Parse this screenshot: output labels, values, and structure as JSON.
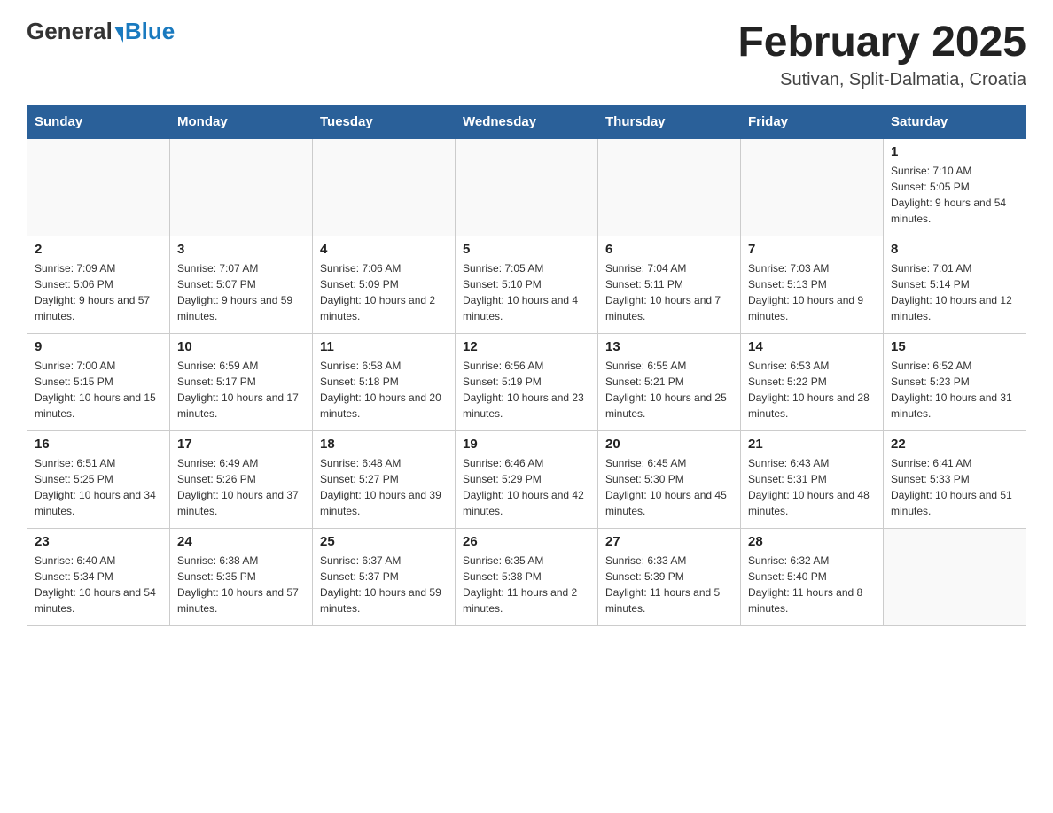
{
  "header": {
    "logo_general": "General",
    "logo_blue": "Blue",
    "title": "February 2025",
    "subtitle": "Sutivan, Split-Dalmatia, Croatia"
  },
  "calendar": {
    "days_of_week": [
      "Sunday",
      "Monday",
      "Tuesday",
      "Wednesday",
      "Thursday",
      "Friday",
      "Saturday"
    ],
    "weeks": [
      {
        "cells": [
          {
            "empty": true
          },
          {
            "empty": true
          },
          {
            "empty": true
          },
          {
            "empty": true
          },
          {
            "empty": true
          },
          {
            "empty": true
          },
          {
            "day": "1",
            "sunrise": "Sunrise: 7:10 AM",
            "sunset": "Sunset: 5:05 PM",
            "daylight": "Daylight: 9 hours and 54 minutes."
          }
        ]
      },
      {
        "cells": [
          {
            "day": "2",
            "sunrise": "Sunrise: 7:09 AM",
            "sunset": "Sunset: 5:06 PM",
            "daylight": "Daylight: 9 hours and 57 minutes."
          },
          {
            "day": "3",
            "sunrise": "Sunrise: 7:07 AM",
            "sunset": "Sunset: 5:07 PM",
            "daylight": "Daylight: 9 hours and 59 minutes."
          },
          {
            "day": "4",
            "sunrise": "Sunrise: 7:06 AM",
            "sunset": "Sunset: 5:09 PM",
            "daylight": "Daylight: 10 hours and 2 minutes."
          },
          {
            "day": "5",
            "sunrise": "Sunrise: 7:05 AM",
            "sunset": "Sunset: 5:10 PM",
            "daylight": "Daylight: 10 hours and 4 minutes."
          },
          {
            "day": "6",
            "sunrise": "Sunrise: 7:04 AM",
            "sunset": "Sunset: 5:11 PM",
            "daylight": "Daylight: 10 hours and 7 minutes."
          },
          {
            "day": "7",
            "sunrise": "Sunrise: 7:03 AM",
            "sunset": "Sunset: 5:13 PM",
            "daylight": "Daylight: 10 hours and 9 minutes."
          },
          {
            "day": "8",
            "sunrise": "Sunrise: 7:01 AM",
            "sunset": "Sunset: 5:14 PM",
            "daylight": "Daylight: 10 hours and 12 minutes."
          }
        ]
      },
      {
        "cells": [
          {
            "day": "9",
            "sunrise": "Sunrise: 7:00 AM",
            "sunset": "Sunset: 5:15 PM",
            "daylight": "Daylight: 10 hours and 15 minutes."
          },
          {
            "day": "10",
            "sunrise": "Sunrise: 6:59 AM",
            "sunset": "Sunset: 5:17 PM",
            "daylight": "Daylight: 10 hours and 17 minutes."
          },
          {
            "day": "11",
            "sunrise": "Sunrise: 6:58 AM",
            "sunset": "Sunset: 5:18 PM",
            "daylight": "Daylight: 10 hours and 20 minutes."
          },
          {
            "day": "12",
            "sunrise": "Sunrise: 6:56 AM",
            "sunset": "Sunset: 5:19 PM",
            "daylight": "Daylight: 10 hours and 23 minutes."
          },
          {
            "day": "13",
            "sunrise": "Sunrise: 6:55 AM",
            "sunset": "Sunset: 5:21 PM",
            "daylight": "Daylight: 10 hours and 25 minutes."
          },
          {
            "day": "14",
            "sunrise": "Sunrise: 6:53 AM",
            "sunset": "Sunset: 5:22 PM",
            "daylight": "Daylight: 10 hours and 28 minutes."
          },
          {
            "day": "15",
            "sunrise": "Sunrise: 6:52 AM",
            "sunset": "Sunset: 5:23 PM",
            "daylight": "Daylight: 10 hours and 31 minutes."
          }
        ]
      },
      {
        "cells": [
          {
            "day": "16",
            "sunrise": "Sunrise: 6:51 AM",
            "sunset": "Sunset: 5:25 PM",
            "daylight": "Daylight: 10 hours and 34 minutes."
          },
          {
            "day": "17",
            "sunrise": "Sunrise: 6:49 AM",
            "sunset": "Sunset: 5:26 PM",
            "daylight": "Daylight: 10 hours and 37 minutes."
          },
          {
            "day": "18",
            "sunrise": "Sunrise: 6:48 AM",
            "sunset": "Sunset: 5:27 PM",
            "daylight": "Daylight: 10 hours and 39 minutes."
          },
          {
            "day": "19",
            "sunrise": "Sunrise: 6:46 AM",
            "sunset": "Sunset: 5:29 PM",
            "daylight": "Daylight: 10 hours and 42 minutes."
          },
          {
            "day": "20",
            "sunrise": "Sunrise: 6:45 AM",
            "sunset": "Sunset: 5:30 PM",
            "daylight": "Daylight: 10 hours and 45 minutes."
          },
          {
            "day": "21",
            "sunrise": "Sunrise: 6:43 AM",
            "sunset": "Sunset: 5:31 PM",
            "daylight": "Daylight: 10 hours and 48 minutes."
          },
          {
            "day": "22",
            "sunrise": "Sunrise: 6:41 AM",
            "sunset": "Sunset: 5:33 PM",
            "daylight": "Daylight: 10 hours and 51 minutes."
          }
        ]
      },
      {
        "cells": [
          {
            "day": "23",
            "sunrise": "Sunrise: 6:40 AM",
            "sunset": "Sunset: 5:34 PM",
            "daylight": "Daylight: 10 hours and 54 minutes."
          },
          {
            "day": "24",
            "sunrise": "Sunrise: 6:38 AM",
            "sunset": "Sunset: 5:35 PM",
            "daylight": "Daylight: 10 hours and 57 minutes."
          },
          {
            "day": "25",
            "sunrise": "Sunrise: 6:37 AM",
            "sunset": "Sunset: 5:37 PM",
            "daylight": "Daylight: 10 hours and 59 minutes."
          },
          {
            "day": "26",
            "sunrise": "Sunrise: 6:35 AM",
            "sunset": "Sunset: 5:38 PM",
            "daylight": "Daylight: 11 hours and 2 minutes."
          },
          {
            "day": "27",
            "sunrise": "Sunrise: 6:33 AM",
            "sunset": "Sunset: 5:39 PM",
            "daylight": "Daylight: 11 hours and 5 minutes."
          },
          {
            "day": "28",
            "sunrise": "Sunrise: 6:32 AM",
            "sunset": "Sunset: 5:40 PM",
            "daylight": "Daylight: 11 hours and 8 minutes."
          },
          {
            "empty": true
          }
        ]
      }
    ]
  }
}
